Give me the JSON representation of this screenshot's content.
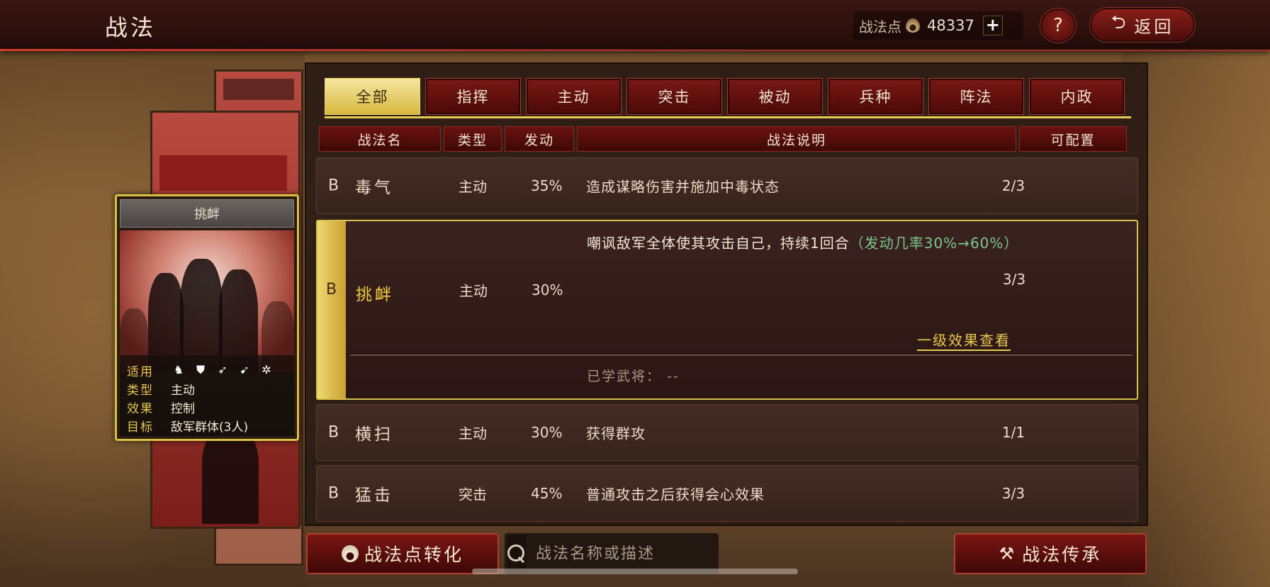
{
  "header": {
    "title": "战法",
    "points_label": "战法点",
    "points_value": "48337",
    "plus_label": "+",
    "help_label": "?",
    "back_label": "返回"
  },
  "tabs": [
    {
      "label": "全部",
      "active": true
    },
    {
      "label": "指挥",
      "active": false
    },
    {
      "label": "主动",
      "active": false
    },
    {
      "label": "突击",
      "active": false
    },
    {
      "label": "被动",
      "active": false
    },
    {
      "label": "兵种",
      "active": false
    },
    {
      "label": "阵法",
      "active": false
    },
    {
      "label": "内政",
      "active": false
    }
  ],
  "columns": [
    "战法名",
    "类型",
    "发动",
    "战法说明",
    "可配置"
  ],
  "skills": [
    {
      "grade": "B",
      "name": "毒气",
      "type": "主动",
      "rate": "35%",
      "desc": "造成谋略伤害并施加中毒状态",
      "count": "2/3"
    },
    {
      "grade": "B",
      "name": "挑衅",
      "type": "主动",
      "rate": "30%",
      "desc": "嘲讽敌军全体使其攻击自己，持续1回合",
      "desc_extra": "（发动几率30%→60%）",
      "count": "3/3",
      "link": "一级效果查看",
      "learned_label": "已学武将：",
      "learned_value": "--"
    },
    {
      "grade": "B",
      "name": "横扫",
      "type": "主动",
      "rate": "30%",
      "desc": "获得群攻",
      "count": "1/1"
    },
    {
      "grade": "B",
      "name": "猛击",
      "type": "突击",
      "rate": "45%",
      "desc": "普通攻击之后获得会心效果",
      "count": "3/3"
    }
  ],
  "card": {
    "title": "挑衅",
    "rows": [
      {
        "key": "适用",
        "icons": [
          "cavalry-icon",
          "shield-icon",
          "bow-icon",
          "spear-icon",
          "wheel-icon"
        ]
      },
      {
        "key": "类型",
        "value": "主动"
      },
      {
        "key": "效果",
        "value": "控制"
      },
      {
        "key": "目标",
        "value": "敌军群体(3人)"
      }
    ]
  },
  "footer": {
    "convert_label": "战法点转化",
    "search_placeholder": "战法名称或描述",
    "inherit_label": "战法传承"
  }
}
